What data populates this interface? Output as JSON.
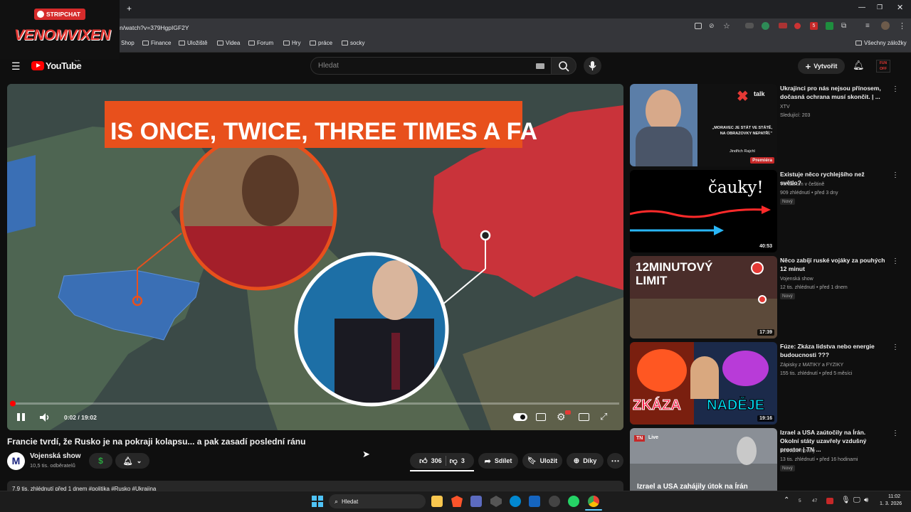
{
  "browser": {
    "url": "n/watch?v=379HgpIGF2Y",
    "bookmarks": [
      "Shop",
      "Finance",
      "Uložiště",
      "Videa",
      "Forum",
      "Hry",
      "práce",
      "socky"
    ],
    "all_bookmarks": "Všechny záložky",
    "ext_badge": "5"
  },
  "overlay": {
    "brand": "STRIPCHAT",
    "name": "VENOMVIXEN"
  },
  "youtube": {
    "logo": "YouTube",
    "logo_sup": "CZ",
    "search_placeholder": "Hledat",
    "create_label": "Vytvořit"
  },
  "player": {
    "banner_text": "IS ONCE, TWICE, THREE TIMES A FA",
    "time": "0:02 / 19:02",
    "progress": 0.002
  },
  "video": {
    "title": "Francie tvrdí, že Rusko je na pokraji kolapsu... a pak zasadí poslední ránu",
    "channel": "Vojenská show",
    "channel_initial": "M",
    "subscribers": "10,5 tis. odběratelů",
    "likes": "306",
    "dislikes": "3",
    "share": "Sdílet",
    "save": "Uložit",
    "thanks": "Díky",
    "description": "7,9 tis. zhlédnutí  před 1 dnem  #politika #Rusko #Ukrajina"
  },
  "recommendations": [
    {
      "title": "Ukrajinci pro nás nejsou přínosem, dočasná ochrana musí skončit. | ...",
      "channel": "XTV",
      "meta": "Sledující: 203",
      "thumb_text": "„MORAVEC JE STÁT VE STÁTĚ, NA OBRAZOVKY NEPATŘÍ.\"",
      "thumb_name": "Jindřich Rajchl",
      "thumb_brand": "talk",
      "thumb_badge": "Premiéra",
      "duration": "",
      "new": ""
    },
    {
      "title": "Existuje něco rychlejšího než světlo?",
      "channel": "Veritasium v češtině",
      "meta": "909 zhlédnutí • před 3 dny",
      "thumb_text": "čauky!",
      "duration": "40:53",
      "new": "Nový"
    },
    {
      "title": "Něco zabíjí ruské vojáky za pouhých 12 minut",
      "channel": "Vojenská show",
      "meta": "12 tis. zhlédnutí • před 1 dnem",
      "thumb_text": "12MINUTOVÝ LIMIT",
      "duration": "17:39",
      "new": "Nový"
    },
    {
      "title": "Fúze: Zkáza lidstva nebo energie budoucnosti ???",
      "channel": "Zápisky z MATIKY a FYZIKY",
      "meta": "155 tis. zhlédnutí • před 5 měsíci",
      "thumb_left": "ZKÁZA",
      "thumb_right": "NADĚJE",
      "duration": "19:16",
      "new": ""
    },
    {
      "title": "Izrael a USA zaútočily na Írán. Okolní státy uzavřely vzdušný prostor | TN ...",
      "channel": "Televizní noviny",
      "meta": "13 tis. zhlédnutí • před 16 hodinami",
      "thumb_text": "Izrael a USA zahájily útok na Írán",
      "thumb_brand": "TN",
      "thumb_live": "Live",
      "duration": "",
      "new": "Nový"
    }
  ],
  "taskbar": {
    "search": "Hledat",
    "time": "11:02",
    "date": "1. 3. 2026",
    "tray_a": "5",
    "tray_b": "47"
  },
  "colors": {
    "accent_red": "#ff0000",
    "bg": "#0f0f0f",
    "banner": "#e8501c"
  }
}
